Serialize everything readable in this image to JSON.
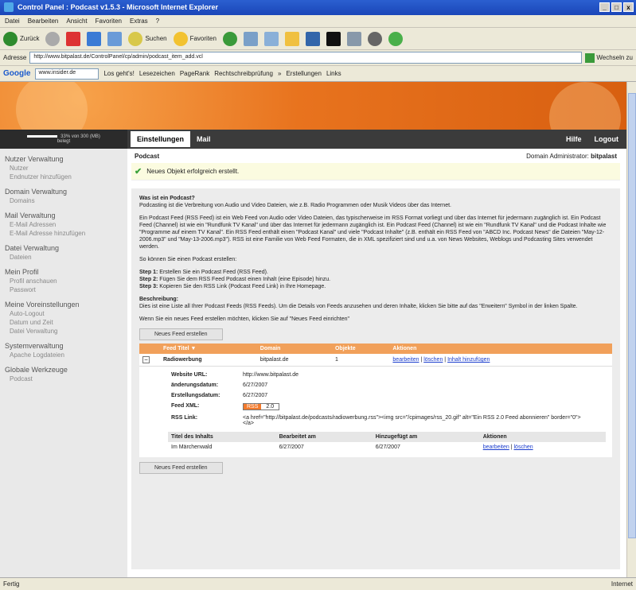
{
  "window": {
    "title": "Control Panel : Podcast v1.5.3 - Microsoft Internet Explorer",
    "buttons": [
      "_",
      "□",
      "x"
    ]
  },
  "menu": [
    "Datei",
    "Bearbeiten",
    "Ansicht",
    "Favoriten",
    "Extras",
    "?"
  ],
  "toolbar": {
    "back": "Zurück",
    "search": "Suchen",
    "favorites": "Favoriten"
  },
  "address": {
    "label": "Adresse",
    "url": "http://www.bitpalast.de/ControlPanel/cp/admin/podcast_item_add.vcl",
    "go": "Wechseln zu"
  },
  "googlebar": {
    "logo": "Google",
    "query": "www.insider.de",
    "go": "Los geht's!",
    "bookmarks": "Lesezeichen",
    "pagerank": "PageRank",
    "spell": "Rechtschreibprüfung",
    "more": "»",
    "extend": "Erstellungen",
    "links": "Links"
  },
  "app": {
    "quota": "33% von 300 (MB)",
    "quota_sub": "belegt",
    "tabs": [
      "Einstellungen",
      "Mail"
    ],
    "help": "Hilfe",
    "logout": "Logout"
  },
  "sidebar": [
    {
      "title": "Nutzer Verwaltung",
      "items": [
        "Nutzer",
        "Endnutzer hinzufügen"
      ]
    },
    {
      "title": "Domain Verwaltung",
      "items": [
        "Domains"
      ]
    },
    {
      "title": "Mail Verwaltung",
      "items": [
        "E-Mail Adressen",
        "E-Mail Adresse hinzufügen"
      ]
    },
    {
      "title": "Datei Verwaltung",
      "items": [
        "Dateien"
      ]
    },
    {
      "title": "Mein Profil",
      "items": [
        "Profil anschauen",
        "Passwort"
      ]
    },
    {
      "title": "Meine Voreinstellungen",
      "items": [
        "Auto-Logout",
        "Datum und Zeit",
        "Datei Verwaltung"
      ]
    },
    {
      "title": "Systemverwaltung",
      "items": [
        "Apache Logdateien"
      ]
    },
    {
      "title": "Globale Werkzeuge",
      "items": [
        "Podcast"
      ]
    }
  ],
  "main": {
    "title": "Podcast",
    "admin_label": "Domain Administrator:",
    "admin_name": "bitpalast",
    "notice": "Neues Objekt erfolgreich erstellt.",
    "what_title": "Was ist ein Podcast?",
    "what_text": "Podcasting ist die Verbreitung von Audio und Video Dateien, wie z.B. Radio Programmen oder Musik Videos über das Internet.",
    "para2": "Ein Podcast Feed (RSS Feed) ist ein Web Feed von Audio oder Video Dateien, das typischerweise im RSS Format vorliegt und über das Internet für jedermann zugänglich ist. Ein Podcast Feed (Channel) ist wie ein \"Rundfunk TV Kanal\" und über das Internet für jedermann zugänglich ist. Ein Podcast Feed (Channel) ist wie ein \"Rundfunk TV Kanal\" und die Podcast Inhalte wie \"Programme auf einem TV Kanal\". Ein RSS Feed enthält einen \"Podcast Kanal\" und viele \"Podcast Inhalte\" (z.B. enthält ein RSS Feed von \"ABCD Inc. Podcast News\" die Dateien \"May-12-2006.mp3\" und \"May-13-2006.mp3\"). RSS ist eine Familie von Web Feed Formaten, die in XML spezifiziert sind und u.a. von News Websites, Weblogs und Podcasting Sites verwendet werden.",
    "how_intro": "So können Sie einen Podcast erstellen:",
    "steps": [
      {
        "label": "Step 1:",
        "text": "Erstellen Sie ein Podcast Feed (RSS Feed)."
      },
      {
        "label": "Step 2:",
        "text": "Fügen Sie dem RSS Feed Podcast einen Inhalt (eine Episode) hinzu."
      },
      {
        "label": "Step 3:",
        "text": "Kopieren Sie den RSS Link (Podcast Feed Link) in Ihre Homepage."
      }
    ],
    "desc_title": "Beschreibung:",
    "desc_text": "Dies ist eine Liste all Ihrer Podcast Feeds (RSS Feeds). Um die Details von Feeds anzusehen und deren Inhalte, klicken Sie bitte auf das \"Erweitern\" Symbol in der linken Spalte.",
    "new_feed_hint": "Wenn Sie ein neues Feed erstellen möchten, klicken Sie auf \"Neues Feed einrichten\"",
    "new_feed_button": "Neues Feed erstellen",
    "table": {
      "headers": [
        "Feed Titel ▼",
        "Domain",
        "Objekte",
        "Aktionen"
      ],
      "row": {
        "toggle": "−",
        "title": "Radiowerbung",
        "domain": "bitpalast.de",
        "objects": "1",
        "actions": [
          "bearbeiten",
          "löschen",
          "Inhalt hinzufügen"
        ]
      }
    },
    "detail": {
      "website_label": "Website URL:",
      "website": "http://www.bitpalast.de",
      "changed_label": "änderungsdatum:",
      "changed": "6/27/2007",
      "created_label": "Erstellungsdatum:",
      "created": "6/27/2007",
      "feed_label": "Feed XML:",
      "rss_badge": "RSS",
      "rss_version": "2.0",
      "rss_link_label": "RSS Link:",
      "rss_link": "<a href=\"http://bitpalast.de/podcasts/radiowerbung.rss\"><img src=\"/cpimages/rss_20.gif\" alt=\"Ein RSS 2.0 Feed abonnieren\" border=\"0\"></a>"
    },
    "items": {
      "headers": [
        "Titel des Inhalts",
        "Bearbeitet am",
        "Hinzugefügt am",
        "Aktionen"
      ],
      "rows": [
        {
          "title": "Im Märchenwald",
          "edited": "6/27/2007",
          "added": "6/27/2007",
          "actions": [
            "bearbeiten",
            "löschen"
          ]
        }
      ]
    }
  },
  "status": {
    "left": "Fertig",
    "right": "Internet"
  }
}
